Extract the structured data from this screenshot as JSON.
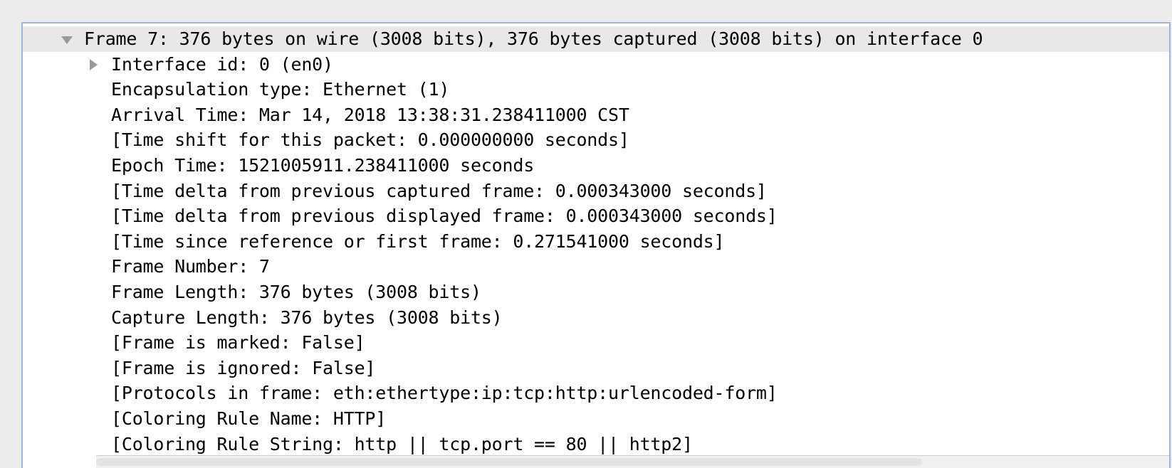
{
  "panel": {
    "name": "packet-details",
    "scrollbar": {
      "orientation": "horizontal"
    }
  },
  "tree": {
    "rows": [
      {
        "depth": 0,
        "twisty": "expanded",
        "selected": true,
        "label": "Frame 7: 376 bytes on wire (3008 bits), 376 bytes captured (3008 bits) on interface 0"
      },
      {
        "depth": 1,
        "twisty": "collapsed",
        "selected": false,
        "label": "Interface id: 0 (en0)"
      },
      {
        "depth": 1,
        "twisty": "none",
        "selected": false,
        "label": "Encapsulation type: Ethernet (1)"
      },
      {
        "depth": 1,
        "twisty": "none",
        "selected": false,
        "label": "Arrival Time: Mar 14, 2018 13:38:31.238411000 CST"
      },
      {
        "depth": 1,
        "twisty": "none",
        "selected": false,
        "label": "[Time shift for this packet: 0.000000000 seconds]"
      },
      {
        "depth": 1,
        "twisty": "none",
        "selected": false,
        "label": "Epoch Time: 1521005911.238411000 seconds"
      },
      {
        "depth": 1,
        "twisty": "none",
        "selected": false,
        "label": "[Time delta from previous captured frame: 0.000343000 seconds]"
      },
      {
        "depth": 1,
        "twisty": "none",
        "selected": false,
        "label": "[Time delta from previous displayed frame: 0.000343000 seconds]"
      },
      {
        "depth": 1,
        "twisty": "none",
        "selected": false,
        "label": "[Time since reference or first frame: 0.271541000 seconds]"
      },
      {
        "depth": 1,
        "twisty": "none",
        "selected": false,
        "label": "Frame Number: 7"
      },
      {
        "depth": 1,
        "twisty": "none",
        "selected": false,
        "label": "Frame Length: 376 bytes (3008 bits)"
      },
      {
        "depth": 1,
        "twisty": "none",
        "selected": false,
        "label": "Capture Length: 376 bytes (3008 bits)"
      },
      {
        "depth": 1,
        "twisty": "none",
        "selected": false,
        "label": "[Frame is marked: False]"
      },
      {
        "depth": 1,
        "twisty": "none",
        "selected": false,
        "label": "[Frame is ignored: False]"
      },
      {
        "depth": 1,
        "twisty": "none",
        "selected": false,
        "label": "[Protocols in frame: eth:ethertype:ip:tcp:http:urlencoded-form]"
      },
      {
        "depth": 1,
        "twisty": "none",
        "selected": false,
        "label": "[Coloring Rule Name: HTTP]"
      },
      {
        "depth": 1,
        "twisty": "none",
        "selected": false,
        "label": "[Coloring Rule String: http || tcp.port == 80 || http2]"
      }
    ]
  },
  "colors": {
    "focus_ring": "#9cb6dc",
    "selection": "#e8e8e8",
    "twisty": "#9a9a9a",
    "background": "#ececec",
    "pane_background": "#ffffff",
    "text": "#000000"
  }
}
